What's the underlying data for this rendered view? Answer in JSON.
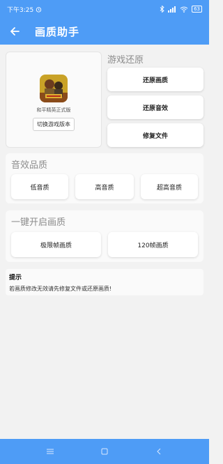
{
  "status_bar": {
    "time": "下午3:25",
    "alarm_icon": "alarm-icon",
    "bluetooth_icon": "bluetooth-icon",
    "signal_icon": "signal-icon",
    "wifi_icon": "wifi-icon",
    "battery": "63"
  },
  "app_bar": {
    "back_icon": "back-arrow-icon",
    "title": "画质助手"
  },
  "game_card": {
    "game_name": "和平精英正式版",
    "switch_button": "切换游戏版本"
  },
  "restore_section": {
    "title": "游戏还原",
    "buttons": [
      "还原画质",
      "还原音效",
      "修复文件"
    ]
  },
  "sound_section": {
    "title": "音效品质",
    "buttons": [
      "低音质",
      "高音质",
      "超高音质"
    ]
  },
  "quality_section": {
    "title": "一键开启画质",
    "buttons": [
      "极限帧画质",
      "120帧画质"
    ]
  },
  "tip": {
    "title": "提示",
    "text": "若画质修改无效请先修复文件或还原画质!"
  },
  "nav_bar": {
    "menu_icon": "menu-icon",
    "home_icon": "home-icon",
    "back_icon": "nav-back-icon"
  },
  "colors": {
    "accent": "#4e9cf6",
    "background": "#f2f2f2"
  }
}
